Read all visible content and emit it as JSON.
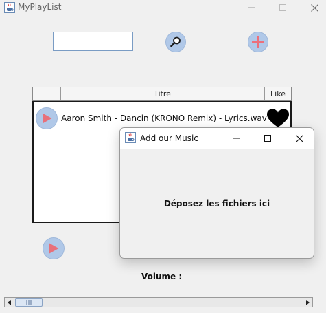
{
  "window": {
    "title": "MyPlayList"
  },
  "search": {
    "value": "",
    "placeholder": ""
  },
  "table": {
    "headers": {
      "play": "",
      "title": "Titre",
      "like": "Like"
    },
    "rows": [
      {
        "title": "Aaron Smith - Dancin (KRONO Remix) - Lyrics.wav",
        "liked": true
      }
    ]
  },
  "volume": {
    "label": "Volume :"
  },
  "dialog": {
    "title": "Add our Music",
    "drop_text": "Déposez les fichiers ici"
  },
  "icons": {
    "app": "java-cup-icon",
    "search": "magnifier-icon",
    "add": "plus-icon",
    "play": "play-icon",
    "like": "heart-icon"
  },
  "colors": {
    "button_bg": "#b0c8e8",
    "play_accent": "#e8707a",
    "add_accent": "#ec6f7b",
    "heart": "#000000"
  }
}
